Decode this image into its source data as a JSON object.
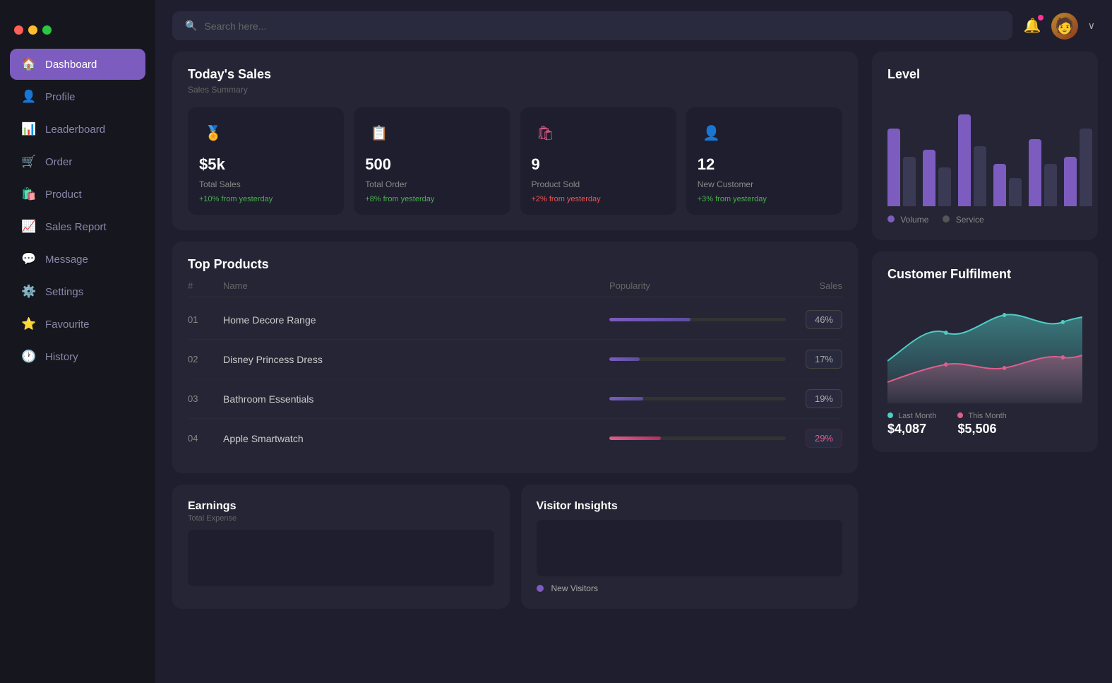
{
  "window": {
    "controls": [
      "red",
      "yellow",
      "green"
    ]
  },
  "sidebar": {
    "items": [
      {
        "id": "dashboard",
        "label": "Dashboard",
        "icon": "🏠",
        "active": true
      },
      {
        "id": "profile",
        "label": "Profile",
        "icon": "👤",
        "active": false
      },
      {
        "id": "leaderboard",
        "label": "Leaderboard",
        "icon": "📊",
        "active": false
      },
      {
        "id": "order",
        "label": "Order",
        "icon": "🛒",
        "active": false
      },
      {
        "id": "product",
        "label": "Product",
        "icon": "🛍️",
        "active": false
      },
      {
        "id": "sales-report",
        "label": "Sales Report",
        "icon": "📈",
        "active": false
      },
      {
        "id": "message",
        "label": "Message",
        "icon": "💬",
        "active": false
      },
      {
        "id": "settings",
        "label": "Settings",
        "icon": "⚙️",
        "active": false
      },
      {
        "id": "favourite",
        "label": "Favourite",
        "icon": "⭐",
        "active": false
      },
      {
        "id": "history",
        "label": "History",
        "icon": "🕐",
        "active": false
      }
    ]
  },
  "topbar": {
    "search_placeholder": "Search here...",
    "chevron": "∨"
  },
  "todays_sales": {
    "title": "Today's Sales",
    "subtitle": "Sales Summary",
    "cards": [
      {
        "icon": "🏅",
        "value": "$5k",
        "label": "Total Sales",
        "change": "+10% from yesterday",
        "change_type": "green"
      },
      {
        "icon": "📋",
        "value": "500",
        "label": "Total Order",
        "change": "+8% from yesterday",
        "change_type": "green"
      },
      {
        "icon": "🛍",
        "value": "9",
        "label": "Product Sold",
        "change": "+2% from yesterday",
        "change_type": "red"
      },
      {
        "icon": "👤",
        "value": "12",
        "label": "New Customer",
        "change": "+3% from yesterday",
        "change_type": "green"
      }
    ]
  },
  "top_products": {
    "title": "Top Products",
    "headers": [
      "#",
      "Name",
      "Popularity",
      "Sales"
    ],
    "rows": [
      {
        "num": "01",
        "name": "Home Decore Range",
        "popularity": 46,
        "sales": "46%",
        "bar_type": "purple"
      },
      {
        "num": "02",
        "name": "Disney Princess Dress",
        "popularity": 17,
        "sales": "17%",
        "bar_type": "purple"
      },
      {
        "num": "03",
        "name": "Bathroom Essentials",
        "popularity": 19,
        "sales": "19%",
        "bar_type": "purple"
      },
      {
        "num": "04",
        "name": "Apple Smartwatch",
        "popularity": 29,
        "sales": "29%",
        "bar_type": "pink"
      }
    ]
  },
  "earnings": {
    "title": "Earnings",
    "subtitle": "Total Expense"
  },
  "visitor_insights": {
    "title": "Visitor Insights",
    "new_visitors_label": "New Visitors"
  },
  "level": {
    "title": "Level",
    "legend": {
      "volume": "Volume",
      "service": "Service"
    },
    "bars": [
      {
        "volume": 110,
        "service": 70
      },
      {
        "volume": 80,
        "service": 55
      },
      {
        "volume": 130,
        "service": 85
      },
      {
        "volume": 60,
        "service": 40
      },
      {
        "volume": 95,
        "service": 60
      },
      {
        "volume": 70,
        "service": 110
      }
    ]
  },
  "customer_fulfilment": {
    "title": "Customer Fulfilment",
    "last_month_label": "Last Month",
    "this_month_label": "This Month",
    "last_month_value": "$4,087",
    "this_month_value": "$5,506"
  }
}
